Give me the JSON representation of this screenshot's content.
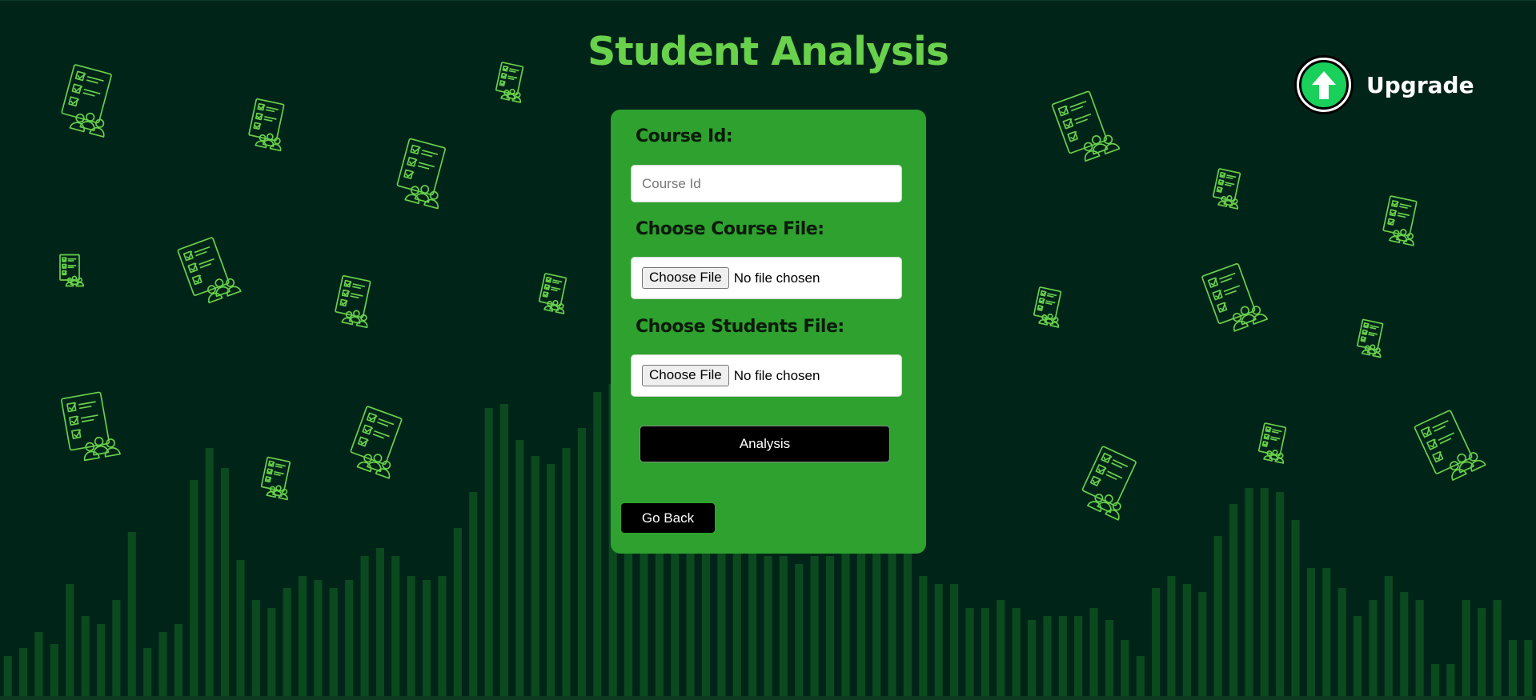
{
  "page": {
    "title": "Student Analysis"
  },
  "upgrade": {
    "label": "Upgrade",
    "icon": "arrow-up-icon"
  },
  "form": {
    "course_id": {
      "label": "Course Id:",
      "placeholder": "Course Id",
      "value": ""
    },
    "course_file": {
      "label": "Choose Course File:",
      "button_label": "Choose File",
      "status": "No file chosen"
    },
    "students_file": {
      "label": "Choose Students File:",
      "button_label": "Choose File",
      "status": "No file chosen"
    },
    "analysis_button": "Analysis",
    "back_button": "Go Back"
  },
  "decor": {
    "icon": "checklist-group-icon"
  },
  "colors": {
    "background": "#012419",
    "accent": "#69d14b",
    "card": "#2ea12e",
    "upgrade_green": "#18d05a",
    "bars": "#0b4a1f"
  }
}
